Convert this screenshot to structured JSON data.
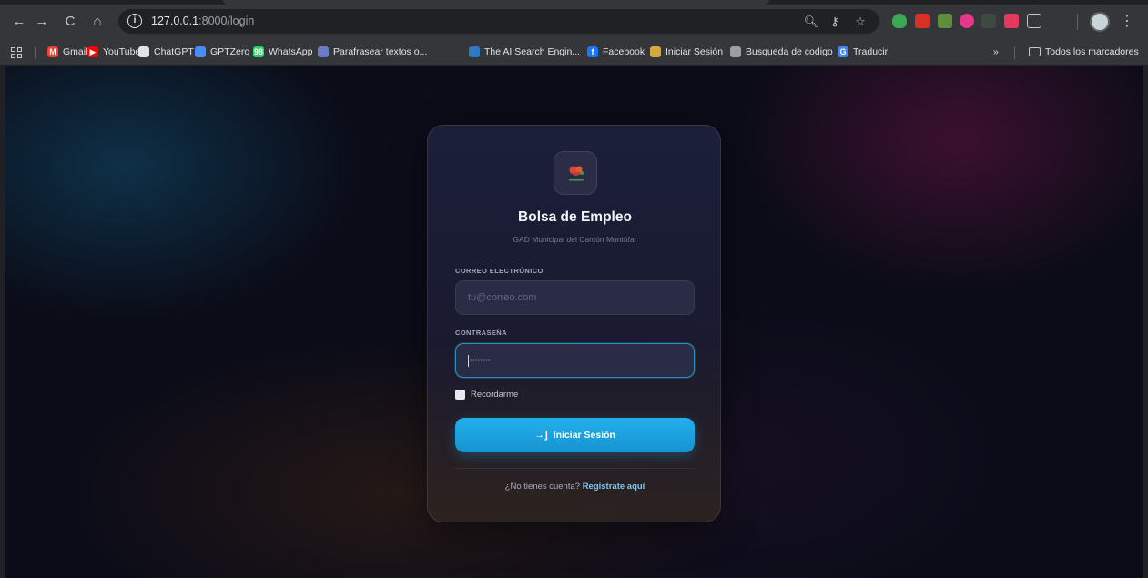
{
  "browser": {
    "url_host": "127.0.0.1",
    "url_path": ":8000/login",
    "bookmarks": [
      {
        "label": "Gmail",
        "icon": "gmail-icon",
        "color": "#ea4335",
        "glyph": "M"
      },
      {
        "label": "YouTube",
        "icon": "youtube-icon",
        "color": "#ff0000",
        "glyph": "▶"
      },
      {
        "label": "ChatGPT",
        "icon": "chatgpt-icon",
        "color": "#e3e3e3",
        "glyph": ""
      },
      {
        "label": "GPTZero",
        "icon": "gptzero-icon",
        "color": "#4a8cf7",
        "glyph": ""
      },
      {
        "label": "WhatsApp",
        "icon": "whatsapp-icon",
        "color": "#25d366",
        "glyph": "98"
      },
      {
        "label": "Parafrasear textos o...",
        "icon": "paraphrase-icon",
        "color": "#6b7cc7",
        "glyph": ""
      },
      {
        "label": "The AI Search Engin...",
        "icon": "ai-search-icon",
        "color": "#2d79c7",
        "glyph": ""
      },
      {
        "label": "Facebook",
        "icon": "facebook-icon",
        "color": "#1877f2",
        "glyph": "f"
      },
      {
        "label": "Iniciar Sesión",
        "icon": "login-site-icon",
        "color": "#d6a93c",
        "glyph": ""
      },
      {
        "label": "Busqueda de codigo",
        "icon": "code-search-icon",
        "color": "#9aa0a6",
        "glyph": ""
      },
      {
        "label": "Traducir",
        "icon": "translate-icon",
        "color": "#4285f4",
        "glyph": "G"
      }
    ],
    "overflow_label": "»",
    "all_bookmarks_label": "Todos los marcadores"
  },
  "login": {
    "title": "Bolsa de Empleo",
    "subtitle": "GAD Municipal del Cantón Montúfar",
    "email_label": "CORREO ELECTRÓNICO",
    "email_placeholder": "tu@correo.com",
    "password_label": "CONTRASEÑA",
    "password_placeholder": "••••••••",
    "remember_label": "Recordarme",
    "submit_label": "Iniciar Sesión",
    "register_prompt": "¿No tienes cuenta?",
    "register_link": "Registrate aquí"
  },
  "colors": {
    "accent": "#1a9fdd",
    "link": "#7dc4ee",
    "page_background": "#0b0c18"
  }
}
